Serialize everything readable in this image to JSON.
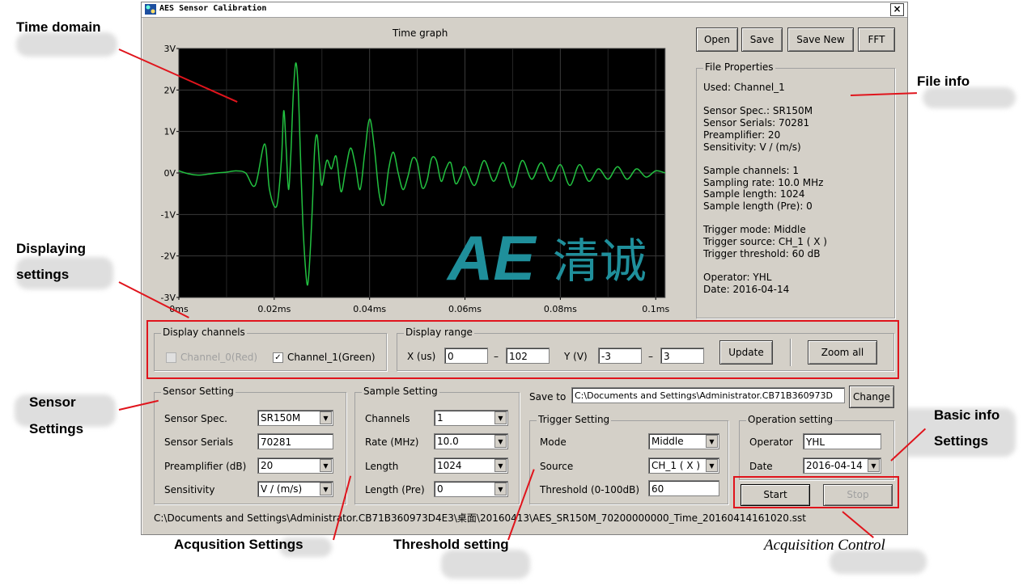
{
  "window": {
    "title": "AES Sensor Calibration",
    "close_glyph": "×"
  },
  "annotations": {
    "time_domain": "Time domain",
    "displaying_1": "Displaying",
    "displaying_2": "settings",
    "sensor_1": "Sensor",
    "sensor_2": "Settings",
    "file_info": "File info",
    "basic_1": "Basic info",
    "basic_2": "Settings",
    "acquisition_settings": "Acqusition Settings",
    "threshold_setting": "Threshold setting",
    "acquisition_control": "Acquisition Control"
  },
  "toolbar": {
    "open": "Open",
    "save": "Save",
    "save_new": "Save New",
    "fft": "FFT"
  },
  "graph": {
    "title": "Time graph",
    "logo_text": "AE",
    "logo_cn": "清诚"
  },
  "chart_data": {
    "type": "line",
    "title": "Time graph",
    "xlabel": "",
    "ylabel": "",
    "xlim": [
      0,
      0.102
    ],
    "ylim": [
      -3,
      3
    ],
    "x_ticks": [
      "0ms",
      "0.02ms",
      "0.04ms",
      "0.06ms",
      "0.08ms",
      "0.1ms"
    ],
    "y_ticks": [
      "3V",
      "2V",
      "1V",
      "0V",
      "-1V",
      "-2V",
      "-3V"
    ],
    "grid": true,
    "line_color": "#22c040",
    "series": [
      {
        "x": [
          0,
          0.002,
          0.004,
          0.006,
          0.008,
          0.01,
          0.012,
          0.014,
          0.016,
          0.018,
          0.019,
          0.0205,
          0.0215,
          0.022,
          0.0225,
          0.023,
          0.0235,
          0.024,
          0.0245,
          0.025,
          0.0255,
          0.026,
          0.0265,
          0.027,
          0.0275,
          0.028,
          0.0285,
          0.029,
          0.0295,
          0.03,
          0.031,
          0.032,
          0.033,
          0.034,
          0.035,
          0.036,
          0.037,
          0.038,
          0.039,
          0.04,
          0.041,
          0.042,
          0.043,
          0.044,
          0.045,
          0.046,
          0.047,
          0.048,
          0.049,
          0.05,
          0.051,
          0.052,
          0.053,
          0.054,
          0.055,
          0.056,
          0.057,
          0.058,
          0.059,
          0.06,
          0.062,
          0.064,
          0.066,
          0.068,
          0.07,
          0.072,
          0.074,
          0.076,
          0.078,
          0.08,
          0.082,
          0.084,
          0.086,
          0.088,
          0.09,
          0.092,
          0.094,
          0.096,
          0.098,
          0.1,
          0.102
        ],
        "values": [
          0.05,
          -0.02,
          -0.05,
          -0.03,
          0.0,
          0.02,
          0.05,
          0.0,
          -0.3,
          0.7,
          -0.4,
          -0.8,
          0.3,
          1.5,
          0.6,
          -0.4,
          0.5,
          1.9,
          2.65,
          2.1,
          0.4,
          -1.2,
          -2.2,
          -2.7,
          -2.0,
          -0.8,
          0.6,
          0.9,
          0.2,
          -0.3,
          0.3,
          0.1,
          0.4,
          -0.45,
          0.1,
          0.6,
          0.2,
          -0.4,
          0.5,
          1.3,
          0.6,
          -0.5,
          -0.75,
          0.1,
          0.5,
          0.0,
          -0.4,
          -0.1,
          0.35,
          0.25,
          -0.35,
          -0.2,
          0.35,
          0.3,
          -0.2,
          0.1,
          0.25,
          -0.25,
          -0.1,
          0.15,
          -0.3,
          0.3,
          -0.2,
          0.25,
          -0.35,
          0.3,
          -0.15,
          0.25,
          -0.2,
          0.2,
          -0.3,
          0.2,
          -0.2,
          0.1,
          -0.15,
          0.15,
          -0.15,
          0.1,
          -0.1,
          0.05,
          0.0
        ]
      }
    ]
  },
  "file_properties": {
    "legend": "File Properties",
    "lines": [
      "Used:  Channel_1",
      "",
      "Sensor Spec.:  SR150M",
      "Sensor Serials:  70281",
      "Preamplifier:  20",
      "Sensitivity:  V / (m/s)",
      "",
      "Sample channels:  1",
      "Sampling rate:  10.0 MHz",
      "Sample length:  1024",
      "Sample length (Pre):  0",
      "",
      "Trigger mode:  Middle",
      "Trigger source:  CH_1 ( X )",
      "Trigger threshold:  60 dB",
      "",
      "Operator:  YHL",
      "Date:  2016-04-14"
    ]
  },
  "display_channels": {
    "legend": "Display channels",
    "ch0": "Channel_0(Red)",
    "ch1": "Channel_1(Green)",
    "check": "✓"
  },
  "display_range": {
    "legend": "Display range",
    "x_label": "X (us)",
    "x_min": "0",
    "x_max": "102",
    "y_label": "Y (V)",
    "y_min": "-3",
    "y_max": "3",
    "dash": "–",
    "update": "Update",
    "zoom_all": "Zoom all"
  },
  "sensor_setting": {
    "legend": "Sensor Setting",
    "spec_label": "Sensor Spec.",
    "spec": "SR150M",
    "serials_label": "Sensor Serials",
    "serials": "70281",
    "preamp_label": "Preamplifier (dB)",
    "preamp": "20",
    "sens_label": "Sensitivity",
    "sens": "V / (m/s)"
  },
  "sample_setting": {
    "legend": "Sample Setting",
    "channels_label": "Channels",
    "channels": "1",
    "rate_label": "Rate (MHz)",
    "rate": "10.0",
    "length_label": "Length",
    "length": "1024",
    "pre_label": "Length (Pre)",
    "pre": "0"
  },
  "save_to": {
    "label": "Save to",
    "path": "C:\\Documents and Settings\\Administrator.CB71B360973D",
    "change": "Change"
  },
  "trigger_setting": {
    "legend": "Trigger Setting",
    "mode_label": "Mode",
    "mode": "Middle",
    "source_label": "Source",
    "source": "CH_1 ( X )",
    "threshold_label": "Threshold (0-100dB)",
    "threshold": "60"
  },
  "operation_setting": {
    "legend": "Operation setting",
    "operator_label": "Operator",
    "operator": "YHL",
    "date_label": "Date",
    "date": "2016-04-14"
  },
  "control": {
    "start": "Start",
    "stop": "Stop"
  },
  "status": {
    "path": "C:\\Documents and Settings\\Administrator.CB71B360973D4E3\\桌面\\20160413\\AES_SR150M_70200000000_Time_20160414161020.sst"
  },
  "icons": {
    "combo_arrow": "▼"
  }
}
